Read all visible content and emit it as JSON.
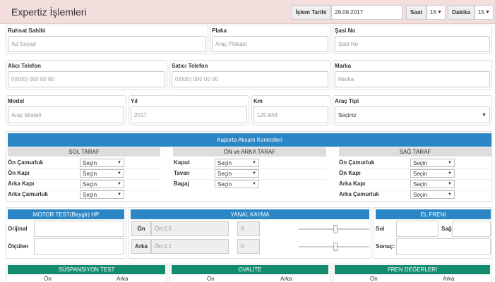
{
  "header": {
    "title": "Expertiz İşlemleri",
    "date_label": "İşlem Tarihi",
    "date_value": "29.09.2017",
    "hour_label": "Saat",
    "hour_value": "16",
    "minute_label": "Dakika",
    "minute_value": "15"
  },
  "fields": {
    "ruhsat": {
      "label": "Ruhsat Sahibi",
      "placeholder": "Ad Soyad"
    },
    "plaka": {
      "label": "Plaka",
      "placeholder": "Araç Plakası"
    },
    "sasi": {
      "label": "Şasi No",
      "placeholder": "Şasi No"
    },
    "alici": {
      "label": "Alıcı Telefon",
      "placeholder": "0(000) 000 00 00"
    },
    "satici": {
      "label": "Satıcı Telefon",
      "placeholder": "0(000) 000 00 00"
    },
    "marka": {
      "label": "Marka",
      "placeholder": "Marka"
    },
    "model": {
      "label": "Model",
      "placeholder": "Araç Modeli"
    },
    "yil": {
      "label": "Yıl",
      "placeholder": "2017"
    },
    "km": {
      "label": "Km",
      "placeholder": "125.848"
    },
    "arac_tipi": {
      "label": "Araç Tipi",
      "value": "Seçiniz"
    }
  },
  "kaporta": {
    "title": "Kaporta Aksam Kontrolleri",
    "select_default": "Seçin",
    "left": {
      "title": "SOL TARAF",
      "rows": [
        "Ön Çamurluk",
        "Ön Kapı",
        "Arka Kapı",
        "Arka Çamurluk"
      ]
    },
    "middle": {
      "title": "ÖN ve ARKA TARAF",
      "rows": [
        "Kaput",
        "Tavan",
        "Bagaj"
      ]
    },
    "right": {
      "title": "SAĞ TARAF",
      "rows": [
        "Ön Çamurluk",
        "Ön Kapı",
        "Arka Kapı",
        "Arka Çamurluk"
      ]
    }
  },
  "motor": {
    "title": "MOTOR TEST(Beygir) HP",
    "orijinal_label": "Orijinal",
    "olculen_label": "Ölçülen"
  },
  "yanal": {
    "title": "YANAL KAYMA",
    "on_label": "Ön",
    "on_placeholder": "Ön:2.5",
    "on_value": "0",
    "arka_label": "Arka",
    "arka_placeholder": "Ön:2.1",
    "arka_value": "0",
    "on_slider_fraction": 0.52,
    "arka_slider_fraction": 0.52
  },
  "elfreni": {
    "title": "EL FRENİ",
    "sol_label": "Sol",
    "sag_label": "Sağ",
    "sonuc_label": "Sonuç:"
  },
  "bottom": {
    "suspansiyon": {
      "title": "SÜSPANSİYON TEST",
      "col1": "Ön",
      "col2": "Arka"
    },
    "ovalite": {
      "title": "OVALİTE",
      "col1": "Ön",
      "col2": "Arka"
    },
    "fren": {
      "title": "FREN DEĞERLERİ",
      "col1": "Ön",
      "col2": "Arka"
    }
  },
  "colors": {
    "header_bg": "#f3dede",
    "blue": "#2a86c4",
    "green": "#138b6f"
  }
}
